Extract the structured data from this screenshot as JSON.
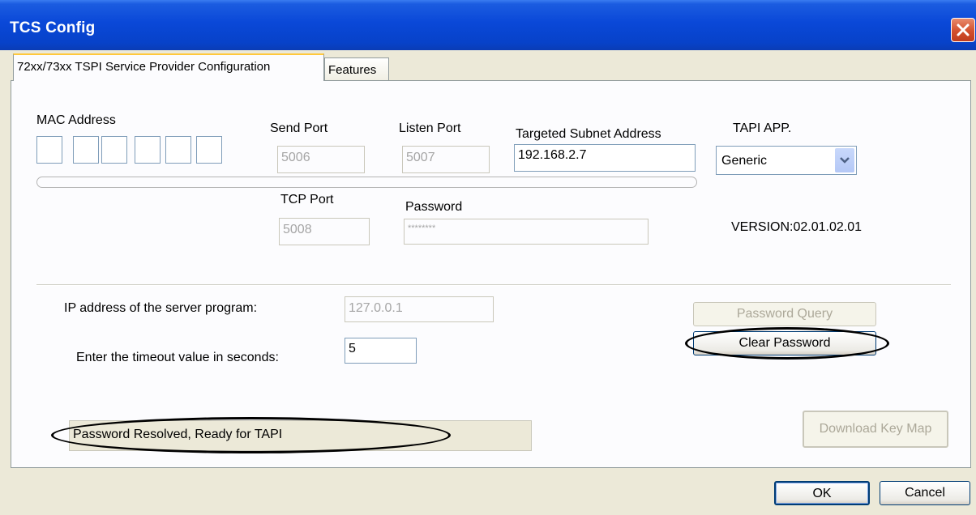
{
  "window": {
    "title": "TCS Config"
  },
  "tabs": [
    {
      "label": "72xx/73xx TSPI Service Provider Configuration"
    },
    {
      "label": "Features"
    }
  ],
  "config": {
    "mac_label": "MAC Address",
    "send_port_label": "Send Port",
    "send_port_value": "5006",
    "listen_port_label": "Listen Port",
    "listen_port_value": "5007",
    "subnet_label": "Targeted Subnet Address",
    "subnet_value": "192.168.2.7",
    "tapi_label": "TAPI APP.",
    "tapi_value": "Generic",
    "tcp_port_label": "TCP Port",
    "tcp_port_value": "5008",
    "password_label": "Password",
    "password_value": "********",
    "version": "VERSION:02.01.02.01"
  },
  "server": {
    "ip_label": "IP address of the server program:",
    "ip_value": "127.0.0.1",
    "timeout_label": "Enter the timeout value in seconds:",
    "timeout_value": "5"
  },
  "buttons": {
    "password_query": "Password Query",
    "clear_password": "Clear Password",
    "download_key_map": "Download Key Map",
    "ok": "OK",
    "cancel": "Cancel"
  },
  "status": {
    "text": "Password Resolved, Ready for TAPI"
  }
}
